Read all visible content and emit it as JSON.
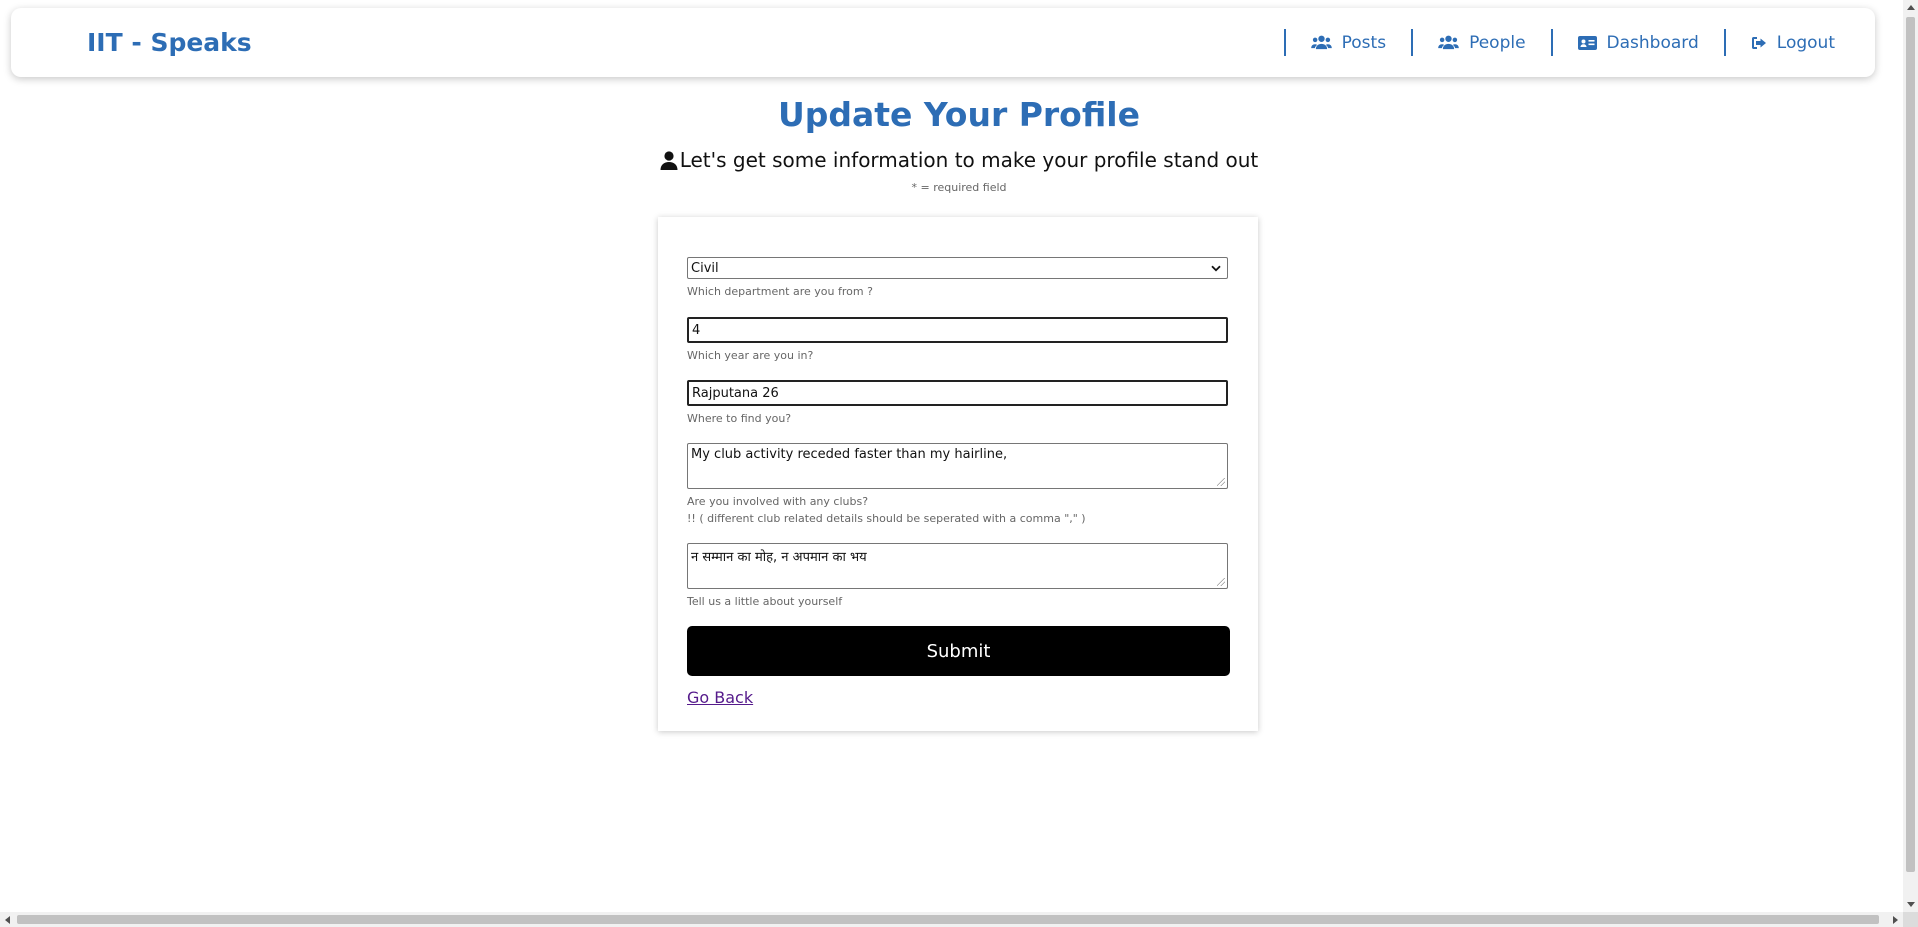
{
  "navbar": {
    "brand": "IIT - Speaks",
    "items": [
      {
        "label": "Posts",
        "icon": "users-icon"
      },
      {
        "label": "People",
        "icon": "users-icon"
      },
      {
        "label": "Dashboard",
        "icon": "id-card-icon"
      },
      {
        "label": "Logout",
        "icon": "sign-out-icon"
      }
    ]
  },
  "header": {
    "title": "Update Your Profile",
    "subtitle": "Let's get some information to make your profile stand out",
    "required_note": "* = required field"
  },
  "form": {
    "department": {
      "value": "Civil",
      "help": "Which department are you from ?"
    },
    "year": {
      "value": "4",
      "help": "Which year are you in?"
    },
    "location": {
      "value": "Rajputana 26",
      "help": "Where to find you?"
    },
    "clubs": {
      "value": "My club activity receded faster than my hairline,",
      "help": "Are you involved with any clubs?",
      "help2": "!! ( different club related details should be seperated with a comma \",\" )"
    },
    "about": {
      "value": "न सम्मान का मोह, न अपमान का भय",
      "help": "Tell us a little about yourself"
    },
    "submit_label": "Submit",
    "back_label": "Go Back"
  },
  "colors": {
    "accent": "#2d6db5",
    "button": "#000000",
    "link_visited": "#551a8b"
  }
}
